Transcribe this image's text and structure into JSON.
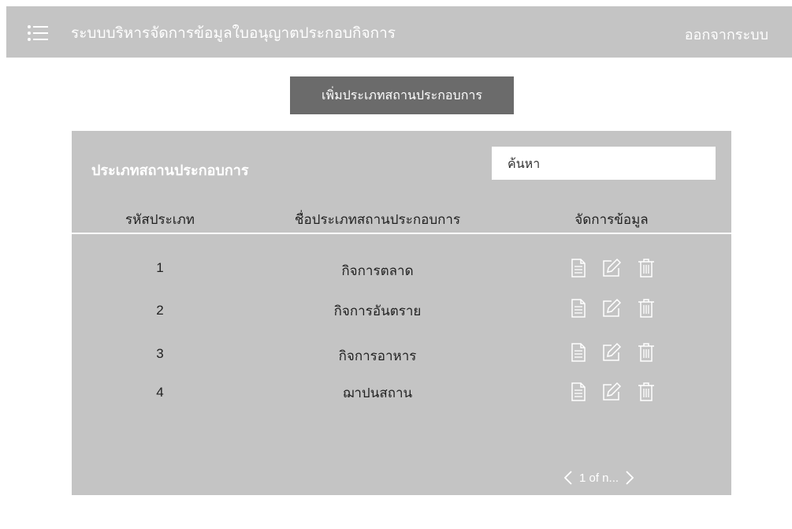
{
  "header": {
    "menu_icon": "menu-icon",
    "title": "ระบบบริหารจัดการข้อมูลใบอนุญาตประกอบกิจการ",
    "logout_label": "ออกจากระบบ"
  },
  "toolbar": {
    "add_label": "เพิ่มประเภทสถานประกอบการ"
  },
  "panel": {
    "title": "ประเภทสถานประกอบการ",
    "search": {
      "placeholder": "ค้นหา",
      "value": ""
    },
    "columns": [
      "รหัสประเภท",
      "ชื่อประเภทสถานประกอบการ",
      "จัดการข้อมูล"
    ],
    "rows": [
      {
        "code": "1",
        "name": "กิจการตลาด"
      },
      {
        "code": "2",
        "name": "กิจการอันตราย"
      },
      {
        "code": "3",
        "name": "กิจการอาหาร"
      },
      {
        "code": "4",
        "name": "ฌาปนสถาน"
      }
    ],
    "row_actions": [
      "view-document-icon",
      "edit-icon",
      "delete-icon"
    ],
    "pager": {
      "text": "1 of n...",
      "prev_icon": "chevron-left-icon",
      "next_icon": "chevron-right-icon"
    }
  },
  "colors": {
    "header_bg": "#c4c4c4",
    "panel_bg": "#c4c4c4",
    "button_bg": "#6b6b6b",
    "text_light": "#ffffff",
    "text_dark": "#222222"
  }
}
